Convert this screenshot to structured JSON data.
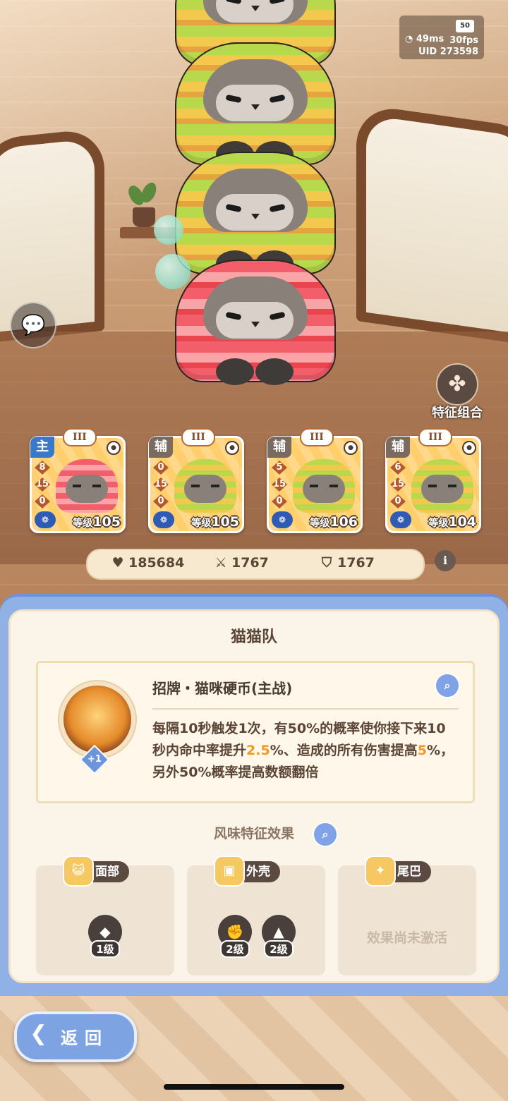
{
  "status": {
    "battery": "50",
    "ping": "49ms",
    "fps": "30fps",
    "uid": "UID 273598"
  },
  "side": {
    "chat_icon": "chat-bubble-icon",
    "trait_label": "特征组合"
  },
  "cards": [
    {
      "tier": "III",
      "role": "主",
      "stats": [
        "8",
        "15",
        "0"
      ],
      "level_prefix": "等级",
      "level": "105"
    },
    {
      "tier": "III",
      "role": "辅",
      "stats": [
        "0",
        "15",
        "0"
      ],
      "level_prefix": "等级",
      "level": "105"
    },
    {
      "tier": "III",
      "role": "辅",
      "stats": [
        "5",
        "15",
        "0"
      ],
      "level_prefix": "等级",
      "level": "106"
    },
    {
      "tier": "III",
      "role": "辅",
      "stats": [
        "6",
        "15",
        "0"
      ],
      "level_prefix": "等级",
      "level": "104"
    }
  ],
  "totals": {
    "hp": "185684",
    "attack": "1767",
    "defense": "1767"
  },
  "panel": {
    "title": "猫猫队",
    "skill": {
      "name": "招牌・猫咪硬币(主战)",
      "badge": "+1",
      "desc_parts": [
        "每隔10秒触发1次，有50%的概率使你接下来10秒内命中率提升",
        "2.5",
        "%、造成的所有伤害提高",
        "5",
        "%，另外50%概率提高数额翻倍"
      ]
    },
    "effects_title": "风味特征效果",
    "effects": [
      {
        "label": "面部",
        "chips": [
          "1级"
        ]
      },
      {
        "label": "外壳",
        "chips": [
          "2级",
          "2级"
        ]
      },
      {
        "label": "尾巴",
        "inactive": "效果尚未激活"
      }
    ]
  },
  "back_label": "返回"
}
